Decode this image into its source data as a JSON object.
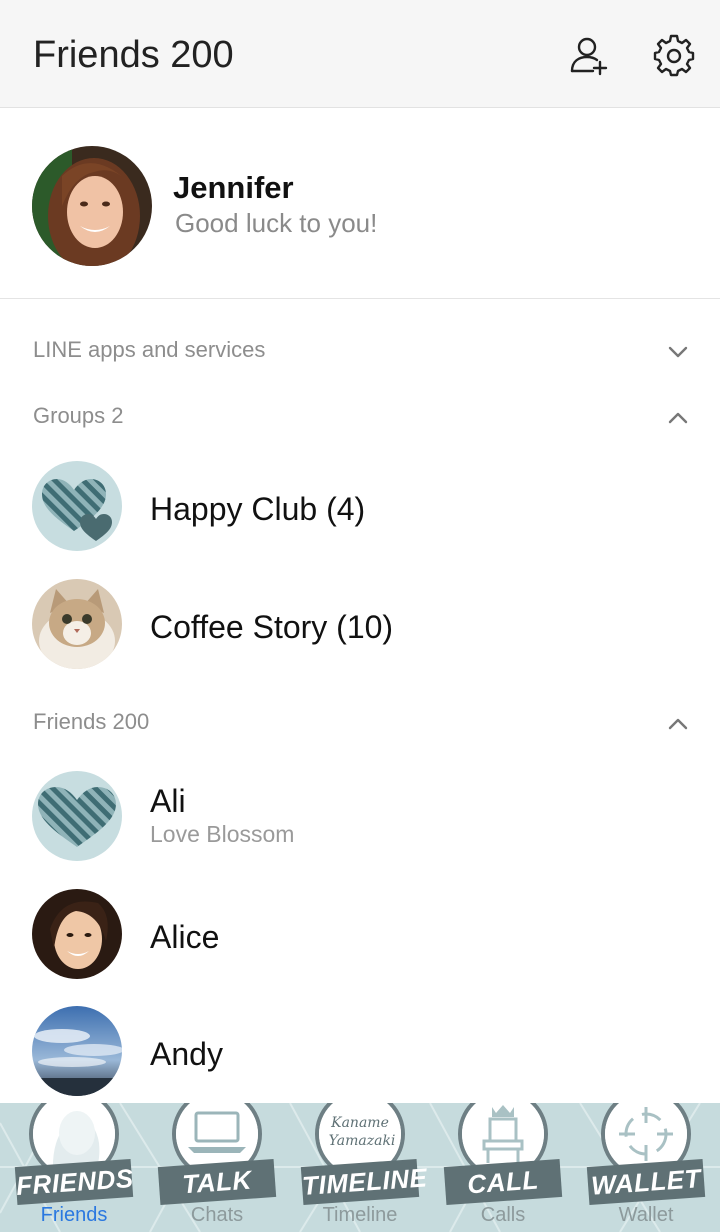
{
  "header": {
    "title": "Friends 200",
    "add_friend_icon": "add-friend-icon",
    "settings_icon": "gear-icon"
  },
  "profile": {
    "name": "Jennifer",
    "status": "Good luck to you!"
  },
  "sections": {
    "services": {
      "label": "LINE apps and services",
      "state": "collapsed"
    },
    "groups": {
      "label": "Groups 2",
      "state": "expanded"
    },
    "friends": {
      "label": "Friends 200",
      "state": "expanded"
    }
  },
  "groups": [
    {
      "name": "Happy Club (4)"
    },
    {
      "name": "Coffee Story (10)"
    }
  ],
  "friends": [
    {
      "name": "Ali",
      "status": "Love Blossom"
    },
    {
      "name": "Alice"
    },
    {
      "name": "Andy"
    }
  ],
  "tabs": [
    {
      "ribbon": "FRIENDS",
      "label": "Friends",
      "active": true
    },
    {
      "ribbon": "TALK",
      "label": "Chats",
      "active": false
    },
    {
      "ribbon": "TIMELINE",
      "label": "Timeline",
      "active": false,
      "badge_text": "Kaname Yamazaki"
    },
    {
      "ribbon": "CALL",
      "label": "Calls",
      "active": false
    },
    {
      "ribbon": "WALLET",
      "label": "Wallet",
      "active": false
    }
  ],
  "colors": {
    "active_tab": "#2a78e0",
    "tabbar_bg": "#c6dbdd",
    "ribbon": "#5f7175",
    "secondary_text": "#8d8d8d"
  }
}
